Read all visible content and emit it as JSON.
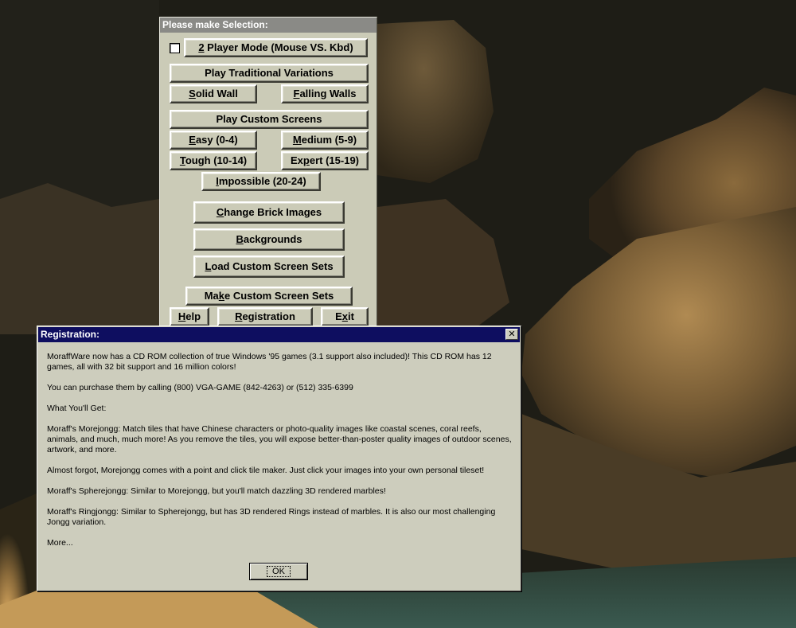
{
  "selection_panel": {
    "title": "Please make Selection:",
    "two_player": {
      "pre": "",
      "ul": "2",
      "post": " Player Mode (Mouse VS. Kbd)",
      "checked": false
    },
    "traditional": {
      "label": "Play Traditional Variations"
    },
    "solid_wall": {
      "pre": "",
      "ul": "S",
      "post": "olid Wall"
    },
    "falling_walls": {
      "pre": "",
      "ul": "F",
      "post": "alling Walls"
    },
    "custom_screens": {
      "label": "Play Custom Screens"
    },
    "easy": {
      "pre": "",
      "ul": "E",
      "post": "asy (0-4)"
    },
    "medium": {
      "pre": "",
      "ul": "M",
      "post": "edium (5-9)"
    },
    "tough": {
      "pre": "",
      "ul": "T",
      "post": "ough (10-14)"
    },
    "expert": {
      "pre": "Ex",
      "ul": "p",
      "post": "ert (15-19)"
    },
    "impossible": {
      "pre": "",
      "ul": "I",
      "post": "mpossible (20-24)"
    },
    "change_bricks": {
      "pre": "",
      "ul": "C",
      "post": "hange Brick Images"
    },
    "backgrounds": {
      "pre": "",
      "ul": "B",
      "post": "ackgrounds"
    },
    "load_sets": {
      "pre": "",
      "ul": "L",
      "post": "oad Custom Screen Sets"
    },
    "make_sets": {
      "pre": "Ma",
      "ul": "k",
      "post": "e Custom Screen Sets"
    },
    "help": {
      "pre": "",
      "ul": "H",
      "post": "elp"
    },
    "registration": {
      "pre": "",
      "ul": "R",
      "post": "egistration"
    },
    "exit": {
      "pre": "E",
      "ul": "x",
      "post": "it"
    }
  },
  "registration_dialog": {
    "title": "Registration:",
    "close_glyph": "✕",
    "paragraphs": [
      "MoraffWare now has a CD ROM collection of true Windows '95 games (3.1 support also included)! This CD ROM has 12 games, all with 32 bit support and 16 million colors!",
      "You can purchase them by calling (800) VGA-GAME (842-4263) or (512) 335-6399",
      "What You'll Get:",
      "Moraff's Morejongg: Match tiles that have Chinese characters or photo-quality images like coastal scenes, coral reefs, animals, and much, much more! As you remove the tiles, you will expose better-than-poster quality images of outdoor scenes, artwork, and more.",
      "Almost forgot, Morejongg comes with a point and click tile maker. Just click your images into your own personal tileset!",
      "Moraff's Spherejongg: Similar to Morejongg, but you'll match dazzling 3D rendered marbles!",
      "Moraff's Ringjongg: Similar to Spherejongg, but has 3D rendered Rings instead of marbles. It is also our most challenging Jongg variation.",
      "More..."
    ],
    "ok_label": "OK"
  },
  "colors": {
    "panel_face": "#cbcbb7",
    "panel_title_bar": "#8a8a86",
    "dialog_title_bar": "#0e0e60"
  }
}
